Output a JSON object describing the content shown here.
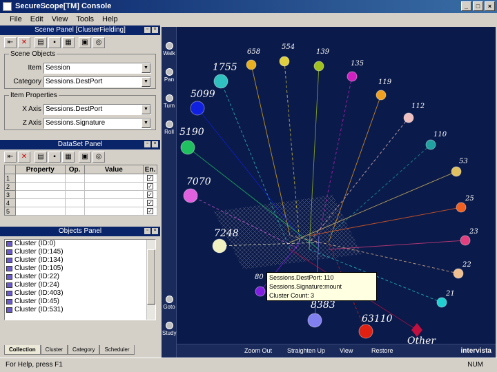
{
  "window": {
    "title": "SecureScope[TM] Console"
  },
  "menu": [
    "File",
    "Edit",
    "View",
    "Tools",
    "Help"
  ],
  "scene_panel": {
    "title": "Scene Panel [ClusterFielding]",
    "scene_objects_legend": "Scene Objects",
    "item_label": "Item",
    "item_value": "Session",
    "category_label": "Category",
    "category_value": "Sessions.DestPort",
    "item_props_legend": "Item Properties",
    "xaxis_label": "X Axis",
    "xaxis_value": "Sessions.DestPort",
    "zaxis_label": "Z Axis",
    "zaxis_value": "Sessions.Signature"
  },
  "dataset_panel": {
    "title": "DataSet Panel",
    "columns": [
      "",
      "Property",
      "Op.",
      "Value",
      "En."
    ],
    "rows": [
      "1",
      "2",
      "3",
      "4",
      "5"
    ]
  },
  "objects_panel": {
    "title": "Objects Panel",
    "items": [
      "Cluster (ID:0)",
      "Cluster (ID:145)",
      "Cluster (ID:134)",
      "Cluster (ID:105)",
      "Cluster (ID:22)",
      "Cluster (ID:24)",
      "Cluster (ID:403)",
      "Cluster (ID:45)",
      "Cluster (ID:531)"
    ],
    "tabs": [
      "Collection",
      "Cluster",
      "Category",
      "Scheduler"
    ]
  },
  "nav": [
    "Walk",
    "Pan",
    "Turn",
    "Roll",
    "Goto",
    "Study"
  ],
  "bottom": {
    "zoom_out": "Zoom Out",
    "straighten": "Straighten Up",
    "view": "View",
    "restore": "Restore",
    "logo": "intervista"
  },
  "status": {
    "left": "For Help, press F1",
    "right": "NUM"
  },
  "tooltip": [
    "Sessions.DestPort: 110",
    "Sessions.Signature:mount",
    "Cluster Count: 3"
  ],
  "nodes": [
    {
      "label": "658",
      "color": "#e8b020"
    },
    {
      "label": "554",
      "color": "#e0d040"
    },
    {
      "label": "139",
      "color": "#a0c020"
    },
    {
      "label": "135",
      "color": "#d020c0"
    },
    {
      "label": "119",
      "color": "#f0a020"
    },
    {
      "label": "1755",
      "color": "#30c0c0"
    },
    {
      "label": "5099",
      "color": "#1020e0"
    },
    {
      "label": "112",
      "color": "#f0c0c0"
    },
    {
      "label": "5190",
      "color": "#20c060"
    },
    {
      "label": "110",
      "color": "#20a0a0"
    },
    {
      "label": "53",
      "color": "#e0c060"
    },
    {
      "label": "7070",
      "color": "#e060e0"
    },
    {
      "label": "25",
      "color": "#f06020"
    },
    {
      "label": "7248",
      "color": "#f0f0c0"
    },
    {
      "label": "23",
      "color": "#e04080"
    },
    {
      "label": "22",
      "color": "#f0c090"
    },
    {
      "label": "80",
      "color": "#8020e0"
    },
    {
      "label": "21",
      "color": "#20d0d0"
    },
    {
      "label": "8383",
      "color": "#8080f0"
    },
    {
      "label": "63110",
      "color": "#e02010"
    },
    {
      "label": "Other",
      "color": "#c01040"
    }
  ]
}
